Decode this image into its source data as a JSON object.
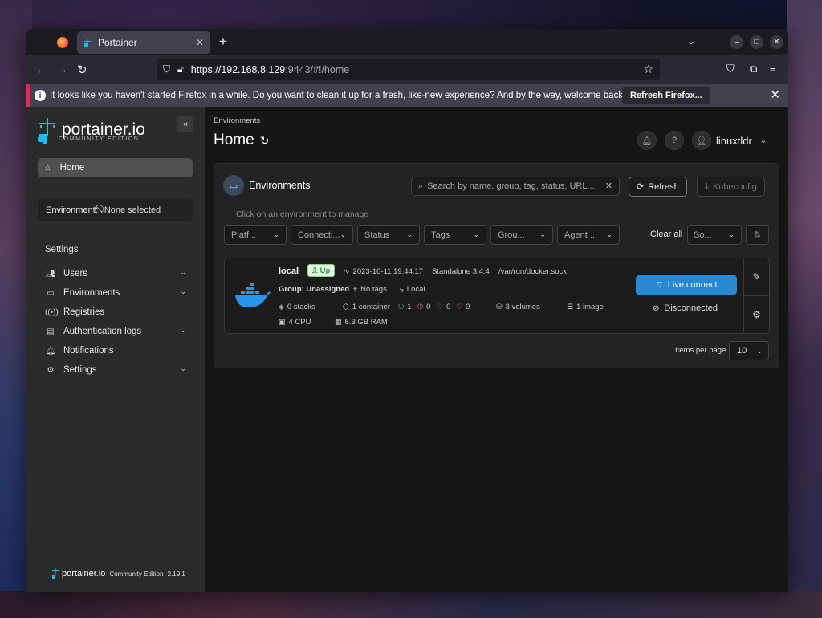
{
  "browser": {
    "tab_title": "Portainer",
    "url_host": "https://192.168.8.129",
    "url_rest": ":9443/#!/home",
    "notification_text": "It looks like you haven't started Firefox in a while. Do you want to clean it up for a fresh, like-new experience? And by the way, welcome back!",
    "notification_button": "Refresh Firefox..."
  },
  "sidebar": {
    "brand_name": "portainer.io",
    "brand_sub": "COMMUNITY EDITION",
    "home_label": "Home",
    "environment_label": "Environment:",
    "environment_value": "None selected",
    "settings_heading": "Settings",
    "items": [
      {
        "label": "Users",
        "icon": "users-icon"
      },
      {
        "label": "Environments",
        "icon": "server-icon"
      },
      {
        "label": "Registries",
        "icon": "broadcast-icon"
      },
      {
        "label": "Authentication logs",
        "icon": "file-icon"
      },
      {
        "label": "Notifications",
        "icon": "bell-icon"
      },
      {
        "label": "Settings",
        "icon": "gear-icon"
      }
    ],
    "footer_brand": "portainer.io",
    "footer_edition": "Community Edition",
    "footer_version": "2.19.1"
  },
  "header": {
    "breadcrumb": "Environments",
    "title": "Home",
    "username": "linuxtldr"
  },
  "panel": {
    "title": "Environments",
    "search_placeholder": "Search by name, group, tag, status, URL...",
    "refresh_label": "Refresh",
    "kubeconfig_label": "Kubeconfig",
    "hint": "Click on an environment to manage",
    "filters": [
      "Platf...",
      "Connecti...",
      "Status",
      "Tags",
      "Grou...",
      "Agent ..."
    ],
    "clear_all": "Clear all",
    "sort_placeholder": "So...",
    "items_per_page_label": "Items per page",
    "items_per_page_value": "10"
  },
  "environment": {
    "name": "local",
    "status": "Up",
    "timestamp": "2023-10-11 19:44:17",
    "type": "Standalone 3.4.4",
    "socket": "/var/run/docker.sock",
    "group_label": "Group:",
    "group_value": "Unassigned",
    "tags": "No tags",
    "location": "Local",
    "stacks": "0 stacks",
    "containers": "1 container",
    "running": "1",
    "stopped": "0",
    "healthy": "0",
    "unhealthy": "0",
    "volumes": "3 volumes",
    "images": "1 image",
    "cpu": "4 CPU",
    "ram": "8.3 GB RAM",
    "live_connect": "Live connect",
    "connection_status": "Disconnected"
  },
  "colors": {
    "accent": "#2589d3",
    "up_green": "#1f9e3b",
    "notification_stripe": "#e22850"
  }
}
